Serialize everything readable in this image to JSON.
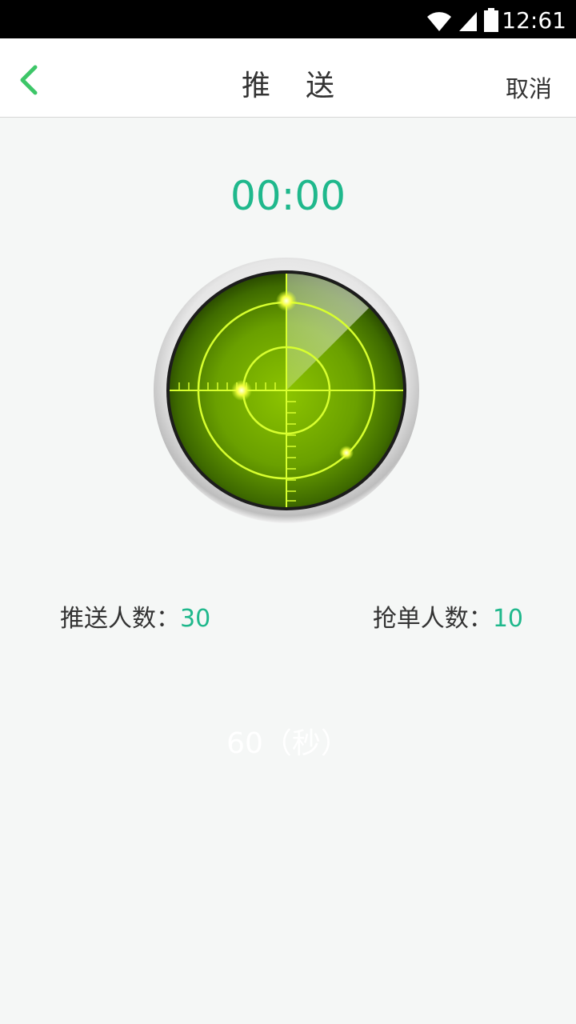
{
  "status_bar": {
    "time": "12:61",
    "icons": [
      "wifi-icon",
      "signal-icon",
      "battery-icon"
    ]
  },
  "header": {
    "title": "推送",
    "cancel_label": "取消",
    "back_icon": "chevron-left-icon"
  },
  "timer": {
    "value": "00:00"
  },
  "stats": {
    "pushed_label": "推送人数：",
    "pushed_value": "30",
    "grabbed_label": "抢单人数：",
    "grabbed_value": "10"
  },
  "duration_label": "60（秒）",
  "colors": {
    "accent": "#1fb88c",
    "back_arrow": "#3dc668",
    "radar_green": "#6aa000",
    "radar_line": "#d8ff2e"
  }
}
